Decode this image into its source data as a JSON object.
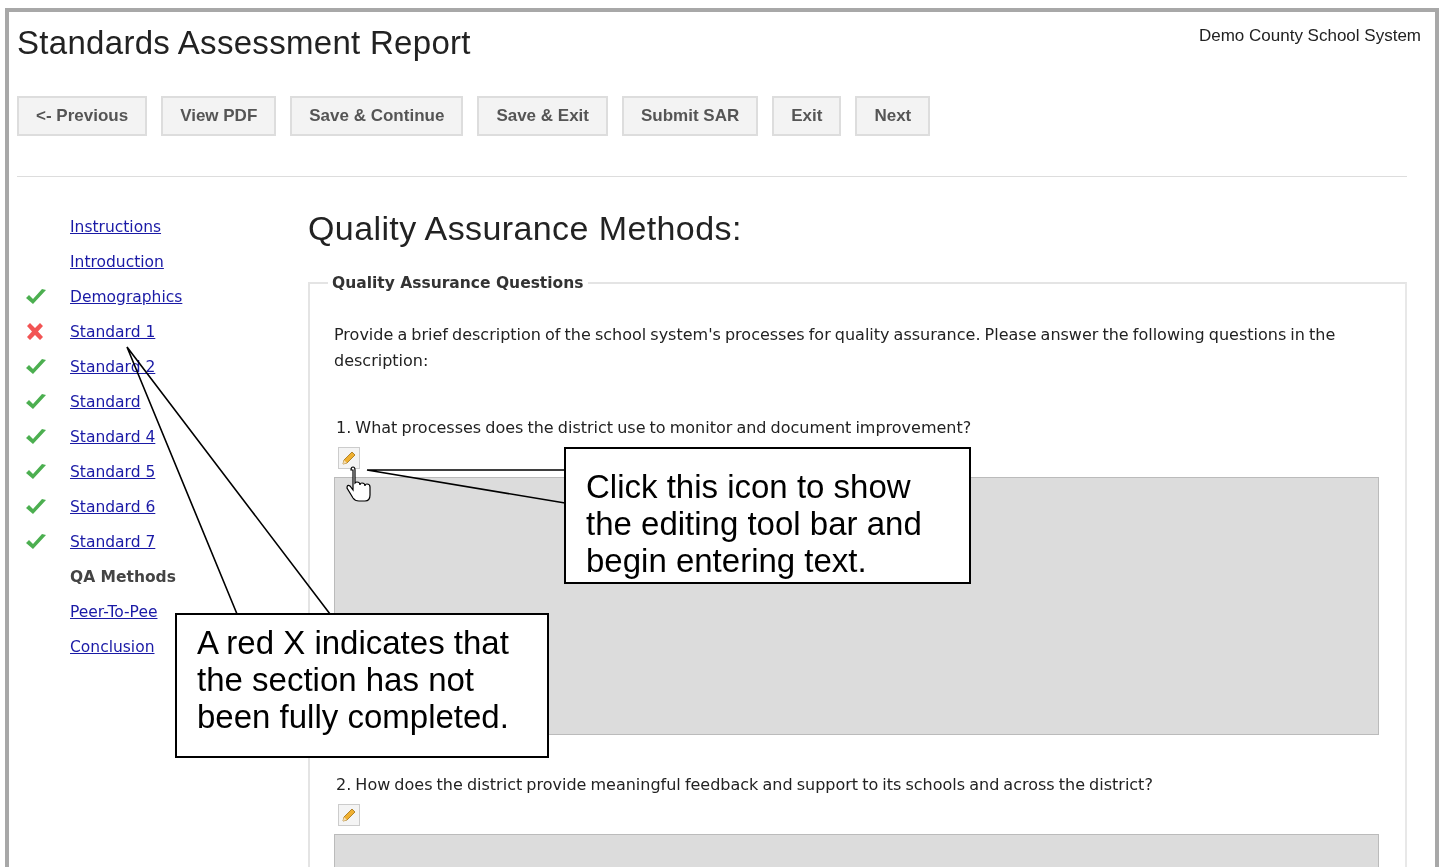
{
  "header": {
    "title": "Standards Assessment Report",
    "organization": "Demo County School System"
  },
  "toolbar": [
    "<- Previous",
    "View PDF",
    "Save & Continue",
    "Save & Exit",
    "Submit SAR",
    "Exit",
    "Next"
  ],
  "sidebar": {
    "items": [
      {
        "label": "Instructions",
        "kind": "plain",
        "selected": false
      },
      {
        "label": "Introduction",
        "kind": "plain",
        "selected": false
      },
      {
        "label": "Demographics",
        "kind": "complete",
        "selected": false
      },
      {
        "label": "Standard 1",
        "kind": "incomplete",
        "selected": false
      },
      {
        "label": "Standard 2",
        "kind": "complete",
        "selected": false
      },
      {
        "label": "Standard",
        "kind": "complete",
        "selected": false
      },
      {
        "label": "Standard 4",
        "kind": "complete",
        "selected": false
      },
      {
        "label": "Standard 5",
        "kind": "complete",
        "selected": false
      },
      {
        "label": "Standard 6",
        "kind": "complete",
        "selected": false
      },
      {
        "label": "Standard 7",
        "kind": "complete",
        "selected": false
      },
      {
        "label": "QA Methods",
        "kind": "plain",
        "selected": true
      },
      {
        "label": "Peer-To-Pee",
        "kind": "plain",
        "selected": false
      },
      {
        "label": "Conclusion",
        "kind": "plain",
        "selected": false
      }
    ]
  },
  "content": {
    "heading": "Quality Assurance Methods:",
    "section": {
      "legend": "Quality Assurance Questions",
      "description": "Provide a brief description of the school system's processes for quality assurance. Please answer the following questions in the description:",
      "questions": [
        {
          "text": "1. What processes does the district use to monitor and document improvement?"
        },
        {
          "text": "2. How does the district provide meaningful feedback and support to its schools and across the district?"
        }
      ]
    }
  },
  "callouts": [
    {
      "text": "Click this icon to show the editing tool bar and begin entering text."
    },
    {
      "text": "A red X indicates that the section has not been fully completed."
    }
  ]
}
